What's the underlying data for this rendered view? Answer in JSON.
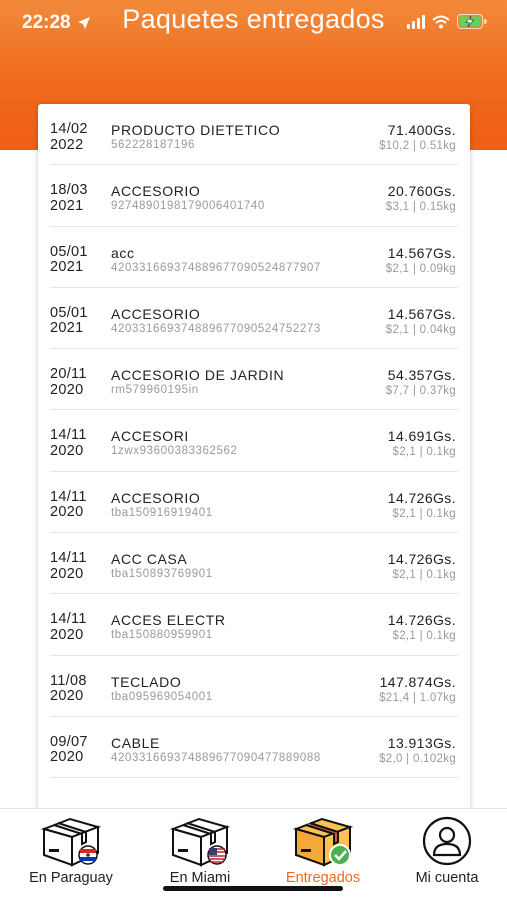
{
  "status_bar": {
    "time": "22:28"
  },
  "header": {
    "title": "Paquetes entregados"
  },
  "packages": [
    {
      "date_day": "14/02",
      "date_year": "2022",
      "description": "PRODUCTO DIETETICO",
      "tracking": "562228187196",
      "price": "71.400Gs.",
      "details": "$10,2 | 0.51kg"
    },
    {
      "date_day": "18/03",
      "date_year": "2021",
      "description": "ACCESORIO",
      "tracking": "9274890198179006401740",
      "price": "20.760Gs.",
      "details": "$3,1 | 0.15kg"
    },
    {
      "date_day": "05/01",
      "date_year": "2021",
      "description": "acc",
      "tracking": "420331669374889677090524877907",
      "price": "14.567Gs.",
      "details": "$2,1 | 0.09kg"
    },
    {
      "date_day": "05/01",
      "date_year": "2021",
      "description": "ACCESORIO",
      "tracking": "420331669374889677090524752273",
      "price": "14.567Gs.",
      "details": "$2,1 | 0.04kg"
    },
    {
      "date_day": "20/11",
      "date_year": "2020",
      "description": "ACCESORIO DE JARDIN",
      "tracking": "rm579960195in",
      "price": "54.357Gs.",
      "details": "$7,7 | 0.37kg"
    },
    {
      "date_day": "14/11",
      "date_year": "2020",
      "description": "ACCESORI",
      "tracking": "1zwx93600383362562",
      "price": "14.691Gs.",
      "details": "$2,1 | 0.1kg"
    },
    {
      "date_day": "14/11",
      "date_year": "2020",
      "description": "ACCESORIO",
      "tracking": "tba150916919401",
      "price": "14.726Gs.",
      "details": "$2,1 | 0.1kg"
    },
    {
      "date_day": "14/11",
      "date_year": "2020",
      "description": "ACC CASA",
      "tracking": "tba150893769901",
      "price": "14.726Gs.",
      "details": "$2,1 | 0.1kg"
    },
    {
      "date_day": "14/11",
      "date_year": "2020",
      "description": "ACCES ELECTR",
      "tracking": "tba150880959901",
      "price": "14.726Gs.",
      "details": "$2,1 | 0.1kg"
    },
    {
      "date_day": "11/08",
      "date_year": "2020",
      "description": "TECLADO",
      "tracking": "tba095969054001",
      "price": "147.874Gs.",
      "details": "$21,4 | 1.07kg"
    },
    {
      "date_day": "09/07",
      "date_year": "2020",
      "description": "CABLE",
      "tracking": "420331669374889677090477889088",
      "price": "13.913Gs.",
      "details": "$2,0 | 0.102kg"
    }
  ],
  "bottom_nav": {
    "items": [
      {
        "label": "En Paraguay",
        "icon": "box-paraguay-icon"
      },
      {
        "label": "En Miami",
        "icon": "box-usa-icon"
      },
      {
        "label": "Entregados",
        "icon": "box-delivered-icon",
        "active": true
      },
      {
        "label": "Mi cuenta",
        "icon": "user-account-icon"
      }
    ]
  },
  "colors": {
    "accent": "#f06a1e",
    "header_top": "#f28a3a",
    "text": "#222222",
    "muted": "#9a9a9a"
  }
}
